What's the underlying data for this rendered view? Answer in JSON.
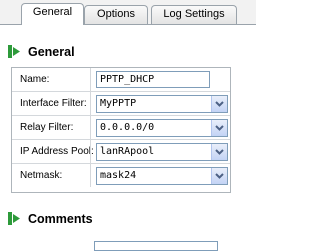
{
  "tabs": [
    {
      "label": "General",
      "active": true
    },
    {
      "label": "Options",
      "active": false
    },
    {
      "label": "Log Settings",
      "active": false
    }
  ],
  "general_section": {
    "title": "General",
    "icon": "arrow-right-icon",
    "fields": {
      "name": {
        "label": "Name:",
        "value": "PPTP_DHCP"
      },
      "interface_filter": {
        "label": "Interface Filter:",
        "value": "MyPPTP"
      },
      "relay_filter": {
        "label": "Relay Filter:",
        "value": "0.0.0.0/0"
      },
      "ip_address_pool": {
        "label": "IP Address Pool:",
        "value": "lanRApool"
      },
      "netmask": {
        "label": "Netmask:",
        "value": "mask24"
      }
    }
  },
  "comments_section": {
    "title": "Comments",
    "icon": "arrow-right-icon"
  },
  "colors": {
    "accent_green": "#2d9a3a",
    "dropdown_arrow": "#4d6185",
    "border": "#7f9db9"
  }
}
